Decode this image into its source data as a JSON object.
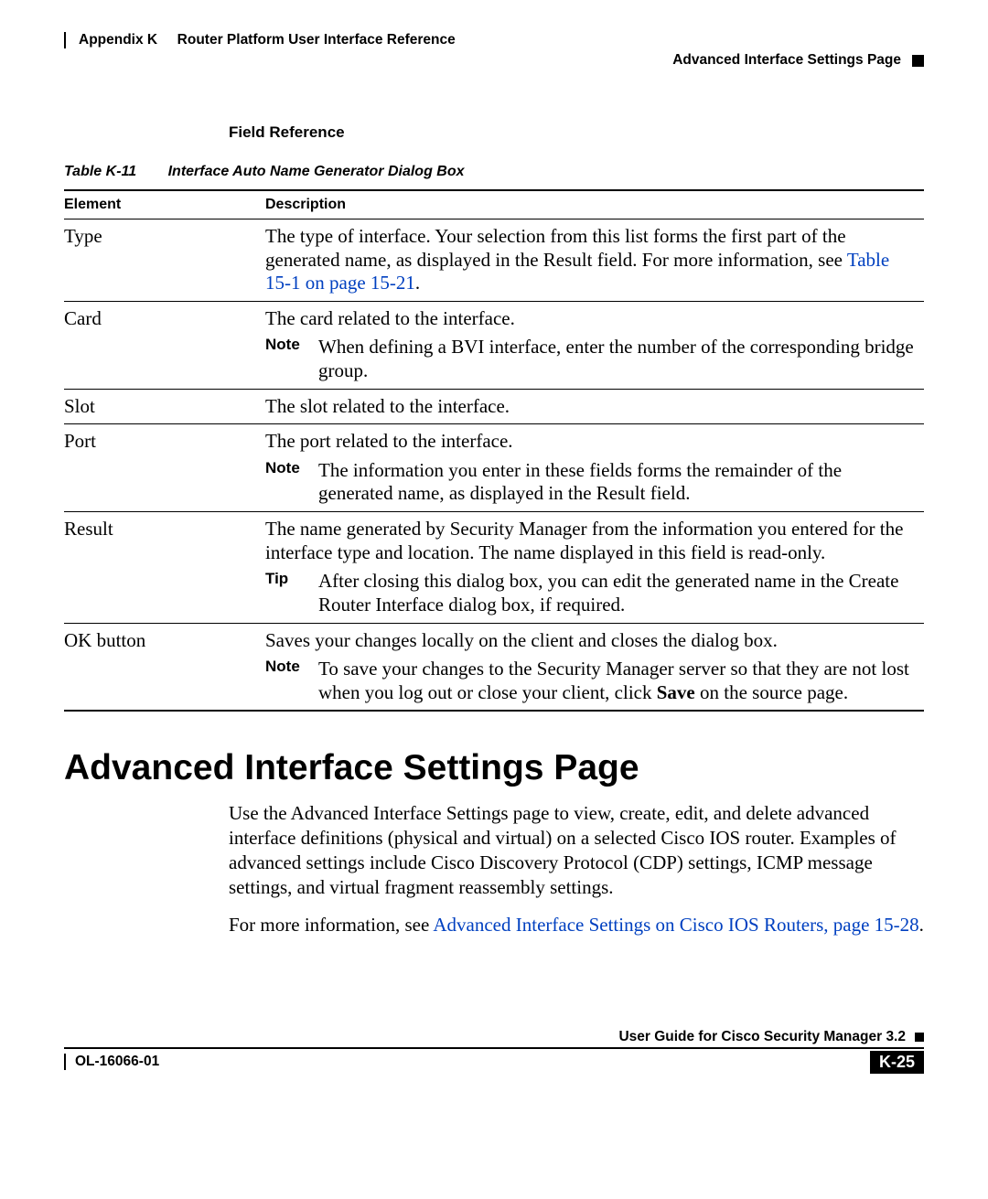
{
  "header": {
    "appendix": "Appendix K",
    "title": "Router Platform User Interface Reference",
    "subheader": "Advanced Interface Settings Page"
  },
  "field_reference_label": "Field Reference",
  "table_caption": {
    "num": "Table K-11",
    "title": "Interface Auto Name Generator Dialog Box"
  },
  "table_headers": {
    "element": "Element",
    "description": "Description"
  },
  "labels": {
    "note": "Note",
    "tip": "Tip",
    "save_bold": "Save"
  },
  "rows": {
    "type": {
      "el": "Type",
      "desc": "The type of interface. Your selection from this list forms the first part of the generated name, as displayed in the Result field. For more information, see ",
      "link": "Table 15-1 on page 15-21",
      "desc_tail": "."
    },
    "card": {
      "el": "Card",
      "desc": "The card related to the interface.",
      "note": "When defining a BVI interface, enter the number of the corresponding bridge group."
    },
    "slot": {
      "el": "Slot",
      "desc": "The slot related to the interface."
    },
    "port": {
      "el": "Port",
      "desc": "The port related to the interface.",
      "note": "The information you enter in these fields forms the remainder of the generated name, as displayed in the Result field."
    },
    "result": {
      "el": "Result",
      "desc": "The name generated by Security Manager from the information you entered for the interface type and location. The name displayed in this field is read-only.",
      "tip": "After closing this dialog box, you can edit the generated name in the Create Router Interface dialog box, if required."
    },
    "ok": {
      "el": "OK button",
      "desc": "Saves your changes locally on the client and closes the dialog box.",
      "note_pre": "To save your changes to the Security Manager server so that they are not lost when you log out or close your client, click ",
      "note_post": " on the source page."
    }
  },
  "section_heading": "Advanced Interface Settings Page",
  "para1": "Use the Advanced Interface Settings page to view, create, edit, and delete advanced interface definitions (physical and virtual) on a selected Cisco IOS router. Examples of advanced settings include Cisco Discovery Protocol (CDP) settings, ICMP message settings, and virtual fragment reassembly settings.",
  "para2_pre": "For more information, see ",
  "para2_link": "Advanced Interface Settings on Cisco IOS Routers, page 15-28",
  "para2_post": ".",
  "footer": {
    "guide": "User Guide for Cisco Security Manager 3.2",
    "doc": "OL-16066-01",
    "page": "K-25"
  }
}
